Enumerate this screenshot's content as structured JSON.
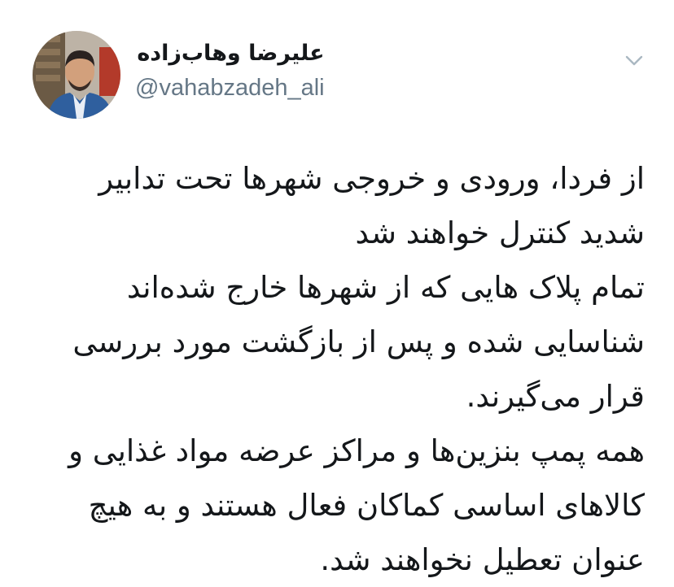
{
  "tweet": {
    "author": {
      "display_name": "علیرضا وهاب‌زاده",
      "handle": "@vahabzadeh_ali",
      "avatar_icon": "user-photo"
    },
    "menu_icon": "chevron-down-icon",
    "text_lines": [
      "از فردا، ورودی و خروجی شهرها تحت تدابیر",
      "شدید کنترل خواهند شد",
      "تمام پلاک هایی که از شهرها خارج شده‌اند",
      "شناسایی شده و پس از بازگشت مورد بررسی",
      "قرار می‌گیرند.",
      "همه پمپ بنزین‌ها و مراکز عرضه مواد غذایی و",
      "کالاهای اساسی کماکان فعال هستند و به هیچ",
      "عنوان تعطیل نخواهند شد."
    ],
    "colors": {
      "text": "#14171a",
      "secondary": "#657786",
      "caret": "#aab8c2"
    }
  }
}
